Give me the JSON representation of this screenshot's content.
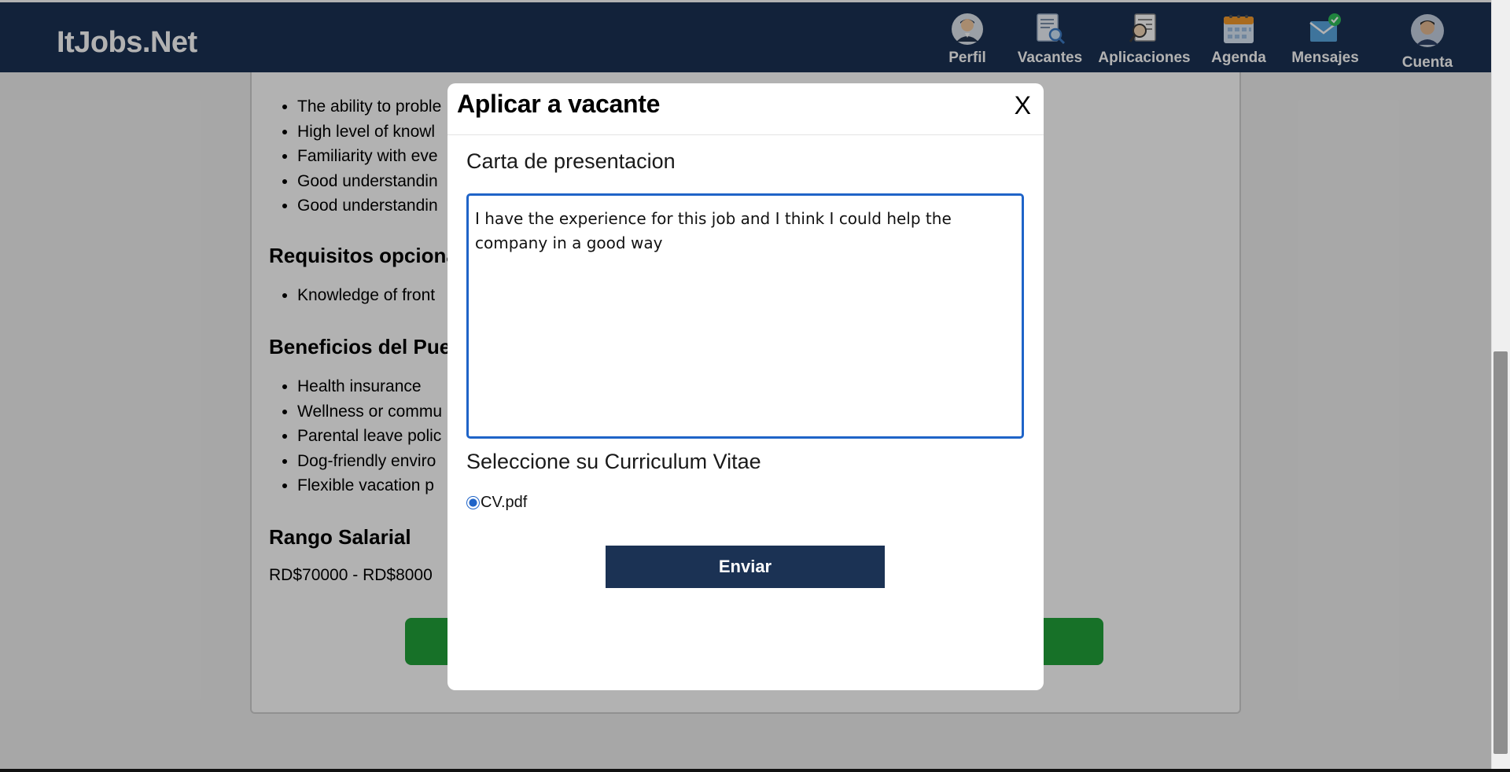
{
  "header": {
    "brand": "ItJobs.Net",
    "nav": [
      {
        "label": "Perfil",
        "icon": "profile-person-icon"
      },
      {
        "label": "Vacantes",
        "icon": "document-search-icon"
      },
      {
        "label": "Aplicaciones",
        "icon": "applications-icon"
      },
      {
        "label": "Agenda",
        "icon": "calendar-icon"
      },
      {
        "label": "Mensajes",
        "icon": "envelope-check-icon"
      },
      {
        "label": "Cuenta",
        "icon": "user-avatar-icon"
      }
    ]
  },
  "page": {
    "requirements_items": [
      "The ability to proble",
      "High level of knowl",
      "Familiarity with eve",
      "Good understandin",
      "Good understandin"
    ],
    "optional_heading": "Requisitos opciona",
    "optional_items": [
      "Knowledge of front"
    ],
    "benefits_heading": "Beneficios del Pue",
    "benefits_items": [
      "Health insurance",
      "Wellness or commu",
      "Parental leave polic",
      "Dog-friendly enviro",
      "Flexible vacation p"
    ],
    "salary_heading": "Rango Salarial",
    "salary_value": "RD$70000 - RD$8000"
  },
  "modal": {
    "title": "Aplicar a vacante",
    "close_label": "X",
    "cover_letter_label": "Carta de presentacion",
    "cover_letter_value": "I have the experience for this job and I think I could help the company in a good way",
    "cv_label": "Seleccione su Curriculum Vitae",
    "cv_option": "CV.pdf",
    "cv_selected": true,
    "submit_label": "Enviar"
  },
  "colors": {
    "navbar": "#1b3254",
    "primary_button": "#1b3254",
    "apply_button": "#21a33a",
    "focus_border": "#1f64c8"
  }
}
